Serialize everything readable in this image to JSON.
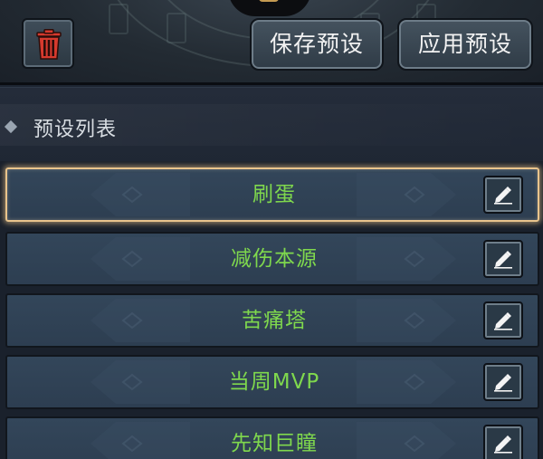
{
  "toolbar": {
    "save_label": "保存预设",
    "apply_label": "应用预设"
  },
  "section": {
    "title": "预设列表"
  },
  "presets": [
    {
      "name": "刷蛋",
      "selected": true
    },
    {
      "name": "减伤本源",
      "selected": false
    },
    {
      "name": "苦痛塔",
      "selected": false
    },
    {
      "name": "当周MVP",
      "selected": false
    },
    {
      "name": "先知巨瞳",
      "selected": false
    }
  ],
  "icons": {
    "delete": "trash-icon",
    "edit": "pencil-icon",
    "bullet": "diamond-icon"
  },
  "colors": {
    "preset_text": "#7fd84d",
    "selected_border": "#e9c48c",
    "trash_red": "#d63a2e"
  }
}
